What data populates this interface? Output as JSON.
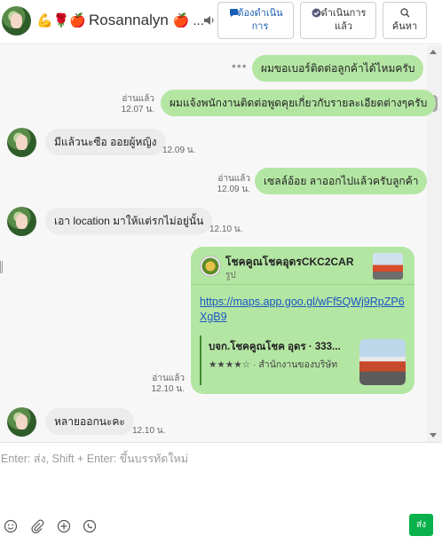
{
  "header": {
    "contact_name": "Rosannalyn",
    "name_prefix": "💪🌹🍎",
    "name_suffix": "🍎 ...",
    "speaker_icon": "speaker-icon",
    "buttons": {
      "todo_label": "ต้องดำเนินการ",
      "done_label": "ดำเนินการแล้ว",
      "search_label": "ค้นหา"
    }
  },
  "messages": [
    {
      "direction": "out",
      "text": "ผมขอเบอร์ติดต่อลูกค้าได้ไหมครับ"
    },
    {
      "direction": "out",
      "text": "ผมแจ้งพนักงานติดต่อพูดคุยเกี่ยวกับรายละเอียดต่างๆครับ",
      "read": "อ่านแล้ว",
      "time": "12.07 น."
    },
    {
      "direction": "in",
      "text": "มีแล้วนะซือ ออยผู้หญิง",
      "time": "12.09 น."
    },
    {
      "direction": "out",
      "text": "เซลล์อ้อย ลาออกไปแล้วครับลูกค้า",
      "read": "อ่านแล้ว",
      "time": "12.09 น."
    },
    {
      "direction": "in",
      "text": "เอา location มาให้แต่รกไม่อยู่นั้น",
      "time": "12.10 น."
    },
    {
      "direction": "in",
      "text": "หลายออกนะคะ",
      "time": "12.10 น."
    }
  ],
  "card": {
    "title": "โชคคูณโชคอุดรCKC2CAR",
    "subtitle": "รูป",
    "link": "https://maps.app.goo.gl/wFf5QWj9RpZP6XgB9",
    "preview_title": "บจก.โชคคูณโชค อุดร · 333...",
    "preview_desc": "★★★★☆ · สำนักงานของบริษัท",
    "read": "อ่านแล้ว",
    "time": "12.10 น."
  },
  "composer": {
    "placeholder": "Enter: ส่ง, Shift + Enter: ขึ้นบรรทัดใหม่",
    "send_label": "ส่ง"
  },
  "colors": {
    "outgoing_bubble": "#b4e6a3",
    "incoming_bubble": "#ececec",
    "send_button": "#08b14a",
    "link": "#1b57c4"
  }
}
